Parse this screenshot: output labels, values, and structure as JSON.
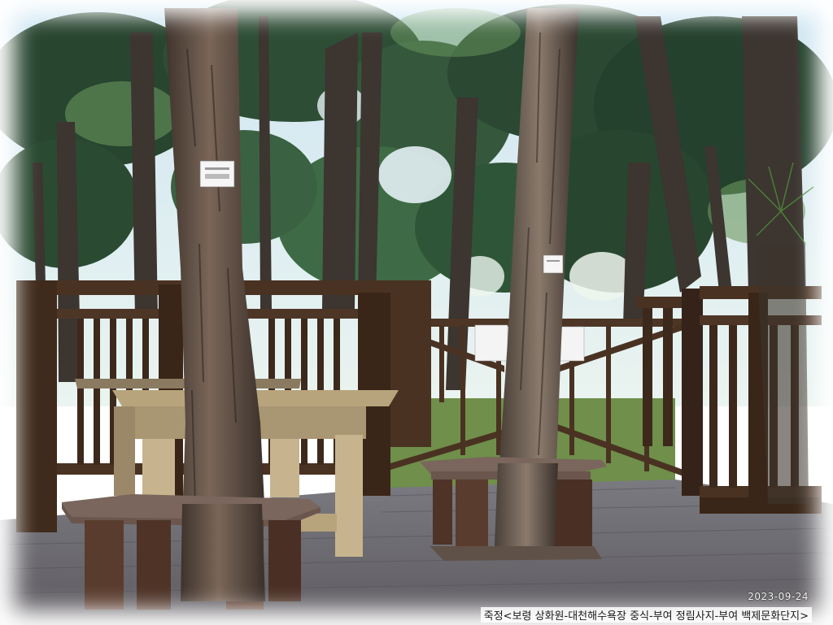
{
  "photo": {
    "date_stamp": "2023-09-24",
    "caption": "죽정<보령 상화원-대천해수욕장 중식-부여 정림사지-부여 백제문화단지>"
  },
  "colors": {
    "sky": "#dfeef6",
    "foliage_dark": "#1f3a2a",
    "foliage_light": "#5f8a56",
    "trunk": "#6a584b",
    "fence": "#4a3222",
    "deck": "#6e6c70",
    "grass": "#6f8f4a"
  }
}
